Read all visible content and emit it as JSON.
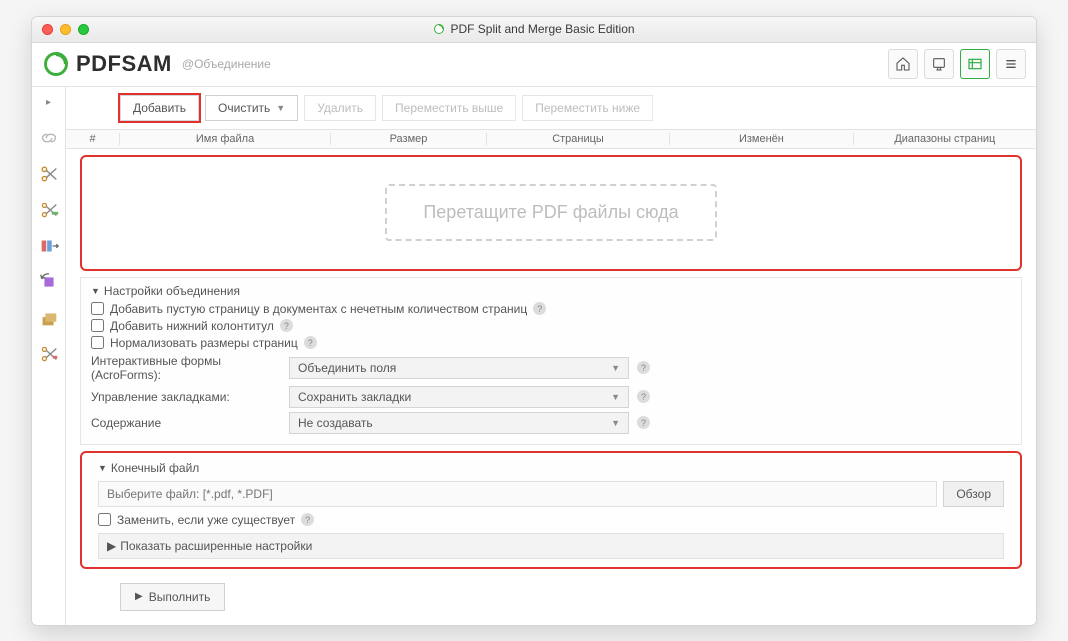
{
  "window": {
    "title": "PDF Split and Merge Basic Edition"
  },
  "brand": {
    "name": "PDFSAM",
    "module": "@Объединение"
  },
  "toolbar": {
    "add": "Добавить",
    "clear": "Очистить",
    "delete": "Удалить",
    "move_up": "Переместить выше",
    "move_down": "Переместить ниже"
  },
  "table_headers": {
    "num": "#",
    "name": "Имя файла",
    "size": "Размер",
    "pages": "Страницы",
    "modified": "Изменён",
    "ranges": "Диапазоны страниц"
  },
  "dropzone_text": "Перетащите PDF файлы сюда",
  "merge_settings": {
    "title": "Настройки объединения",
    "odd_pages": "Добавить пустую страницу в документах с нечетным количеством страниц",
    "footer": "Добавить нижний колонтитул",
    "normalize": "Нормализовать размеры страниц",
    "forms_label": "Интерактивные формы (AcroForms):",
    "forms_value": "Объединить поля",
    "bookmarks_label": "Управление закладками:",
    "bookmarks_value": "Сохранить закладки",
    "toc_label": "Содержание",
    "toc_value": "Не создавать"
  },
  "output": {
    "title": "Конечный файл",
    "placeholder": "Выберите файл: [*.pdf, *.PDF]",
    "browse": "Обзор",
    "overwrite": "Заменить, если уже существует",
    "advanced": "Показать расширенные настройки"
  },
  "run": "Выполнить"
}
